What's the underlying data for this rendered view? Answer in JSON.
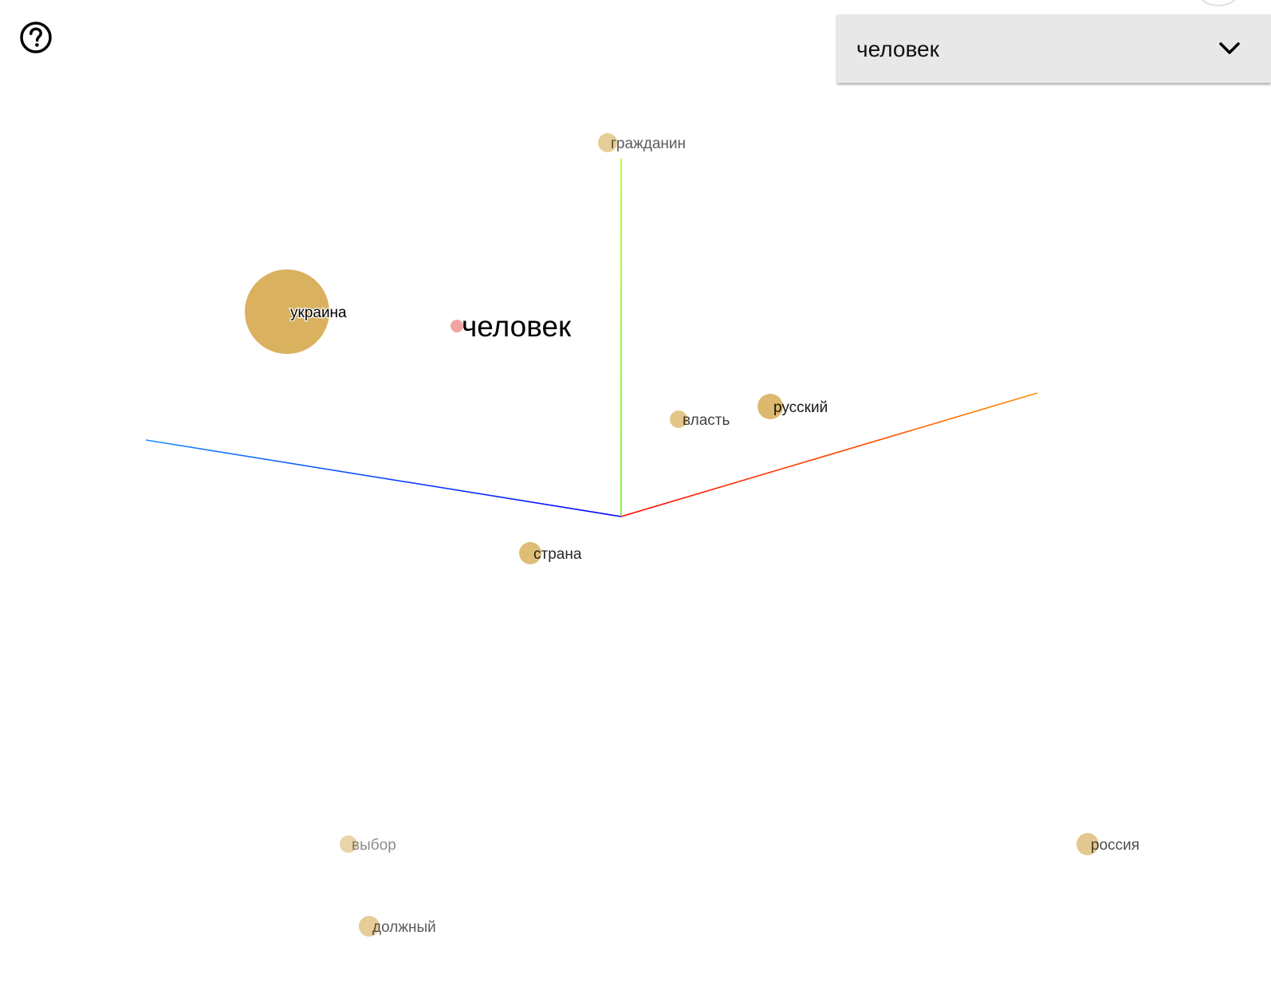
{
  "help": {
    "icon": "help-circle-icon"
  },
  "word_select": {
    "value": "человек",
    "chevron_icon": "chevron-down-icon"
  },
  "scene": {
    "axes": [
      {
        "name": "x-axis",
        "color_start": "#ff0000",
        "color_end": "#ff8c00"
      },
      {
        "name": "y-axis",
        "color_start": "#55ff00",
        "color_end": "#a0ff00"
      },
      {
        "name": "z-axis",
        "color_start": "#0000ff",
        "color_end": "#1a8cff"
      }
    ],
    "query_word": {
      "label": "человек",
      "color": "#f2a3a3"
    },
    "point_color": "#d9b15f",
    "words": [
      {
        "label": "гражданин",
        "opacity": 0.65
      },
      {
        "label": "украина",
        "opacity": 1.0,
        "size": "large"
      },
      {
        "label": "власть",
        "opacity": 0.75
      },
      {
        "label": "русский",
        "opacity": 0.9
      },
      {
        "label": "страна",
        "opacity": 0.85
      },
      {
        "label": "выбор",
        "opacity": 0.45
      },
      {
        "label": "россия",
        "opacity": 0.7
      },
      {
        "label": "должный",
        "opacity": 0.65
      }
    ]
  }
}
